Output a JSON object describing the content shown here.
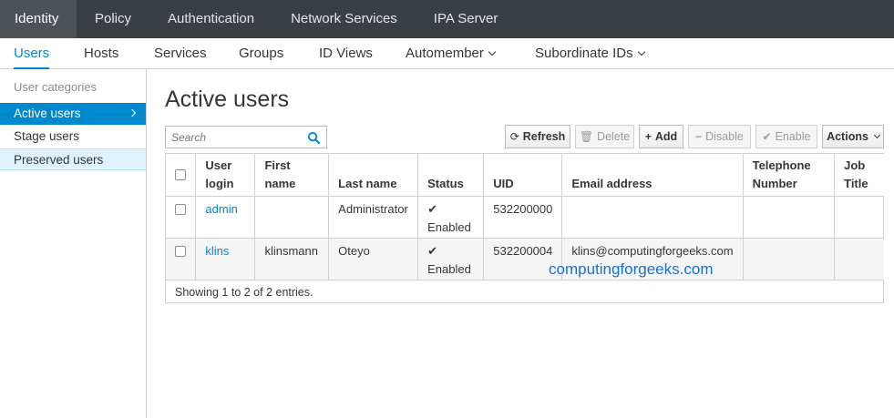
{
  "topnav": {
    "tabs": [
      "Identity",
      "Policy",
      "Authentication",
      "Network Services",
      "IPA Server"
    ]
  },
  "subnav": {
    "tabs": [
      "Users",
      "Hosts",
      "Services",
      "Groups",
      "ID Views",
      "Automember",
      "Subordinate IDs"
    ]
  },
  "sidebar": {
    "category": "User categories",
    "items": [
      "Active users",
      "Stage users",
      "Preserved users"
    ]
  },
  "main": {
    "title": "Active users",
    "search_placeholder": "Search",
    "buttons": {
      "refresh": "Refresh",
      "delete": "Delete",
      "add": "Add",
      "disable": "Disable",
      "enable": "Enable",
      "actions": "Actions"
    }
  },
  "table": {
    "columns": [
      "User login",
      "First name",
      "Last name",
      "Status",
      "UID",
      "Email address",
      "Telephone Number",
      "Job Title"
    ],
    "col_user_login": [
      "User",
      "login"
    ],
    "col_telephone": [
      "Telephone",
      "Number"
    ],
    "col_job_title": [
      "Job",
      "Title"
    ],
    "rows": [
      {
        "login": "admin",
        "first": "",
        "last": "Administrator",
        "status": "Enabled",
        "uid": "532200000",
        "email": "",
        "phone": "",
        "job": ""
      },
      {
        "login": "klins",
        "first": "klinsmann",
        "last": "Oteyo",
        "status": "Enabled",
        "uid": "532200004",
        "email": "klins@computingforgeeks.com",
        "phone": "",
        "job": ""
      }
    ],
    "footer": "Showing 1 to 2 of 2 entries."
  },
  "watermark": "computingforgeeks.com",
  "colors": {
    "accent": "#0088ce",
    "topnav_bg": "#393f44",
    "topnav_active": "#4d5258"
  }
}
